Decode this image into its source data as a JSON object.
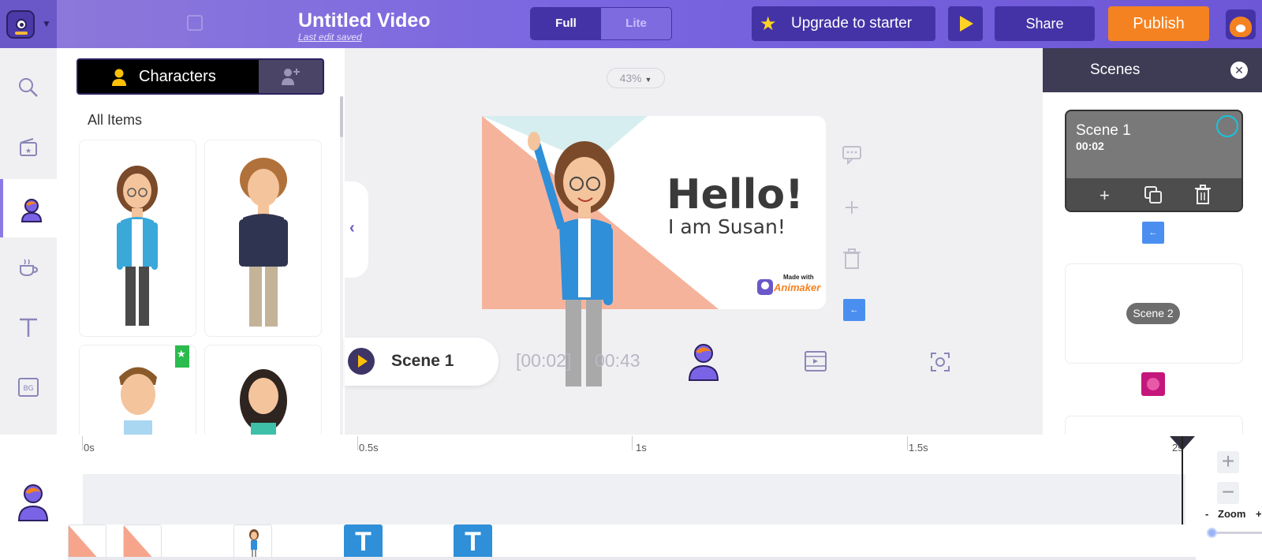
{
  "header": {
    "title": "Untitled Video",
    "subtitle": "Last edit saved",
    "mode_full": "Full",
    "mode_lite": "Lite",
    "upgrade_label": "Upgrade to starter",
    "share_label": "Share",
    "publish_label": "Publish",
    "colors": {
      "bar": "#7a66e0",
      "dark": "#4433a6",
      "publish": "#f58220",
      "star": "#ffd324"
    }
  },
  "rail": {
    "items": [
      {
        "icon": "search-icon"
      },
      {
        "icon": "scene-star-icon"
      },
      {
        "icon": "character-icon",
        "active": true
      },
      {
        "icon": "props-cup-icon"
      },
      {
        "icon": "text-icon"
      },
      {
        "icon": "bg-icon",
        "label": "BG"
      }
    ]
  },
  "characters_panel": {
    "tab_label": "Characters",
    "section_label": "All Items"
  },
  "canvas": {
    "zoom": "43%",
    "stage_heading": "Hello!",
    "stage_subheading": "I am Susan!",
    "watermark_small": "Made with",
    "watermark_brand": "Animaker",
    "scene_label": "Scene 1",
    "scene_time": "[00:02]",
    "total_time": "00:43"
  },
  "scenes_panel": {
    "title": "Scenes",
    "scenes": [
      {
        "name": "Scene 1",
        "duration": "00:02"
      },
      {
        "name": "Scene 2"
      }
    ]
  },
  "timeline": {
    "ticks": [
      "0s",
      "0.5s",
      "1s",
      "1.5s",
      "2s"
    ],
    "zoom_label": "Zoom",
    "zoom_minus": "-",
    "zoom_plus": "+",
    "text_block_label": "T"
  }
}
